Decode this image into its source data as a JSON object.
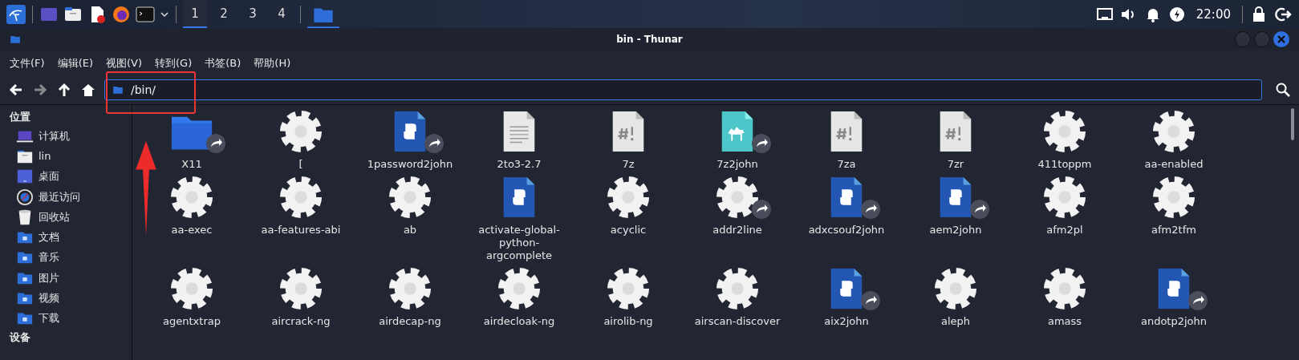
{
  "taskbar": {
    "workspaces": [
      {
        "label": "1",
        "selected": true
      },
      {
        "label": "2",
        "selected": false
      },
      {
        "label": "3",
        "selected": false
      },
      {
        "label": "4",
        "selected": false
      }
    ],
    "clock": "22:00"
  },
  "window": {
    "title": "bin - Thunar"
  },
  "menu": [
    "文件(F)",
    "编辑(E)",
    "视图(V)",
    "转到(G)",
    "书签(B)",
    "帮助(H)"
  ],
  "location": {
    "value": "/bin/"
  },
  "sidebar": {
    "sections": [
      {
        "title": "位置",
        "items": [
          {
            "label": "计算机",
            "kind": "computer"
          },
          {
            "label": "lin",
            "kind": "home"
          },
          {
            "label": "桌面",
            "kind": "desktop"
          },
          {
            "label": "最近访问",
            "kind": "recent"
          },
          {
            "label": "回收站",
            "kind": "trash"
          },
          {
            "label": "文档",
            "kind": "documents"
          },
          {
            "label": "音乐",
            "kind": "music"
          },
          {
            "label": "图片",
            "kind": "pictures"
          },
          {
            "label": "视频",
            "kind": "videos"
          },
          {
            "label": "下载",
            "kind": "downloads"
          }
        ]
      },
      {
        "title": "设备"
      }
    ]
  },
  "files": [
    {
      "name": "X11",
      "kind": "folder",
      "link": true
    },
    {
      "name": "[",
      "kind": "binary",
      "link": false
    },
    {
      "name": "1password2john",
      "kind": "python",
      "link": true
    },
    {
      "name": "2to3-2.7",
      "kind": "text",
      "link": false
    },
    {
      "name": "7z",
      "kind": "script",
      "link": false
    },
    {
      "name": "7z2john",
      "kind": "perl",
      "link": true
    },
    {
      "name": "7za",
      "kind": "script",
      "link": false
    },
    {
      "name": "7zr",
      "kind": "script",
      "link": false
    },
    {
      "name": "411toppm",
      "kind": "binary",
      "link": false
    },
    {
      "name": "aa-enabled",
      "kind": "binary",
      "link": false
    },
    {
      "name": "aa-exec",
      "kind": "binary",
      "link": false
    },
    {
      "name": "aa-features-abi",
      "kind": "binary",
      "link": false
    },
    {
      "name": "ab",
      "kind": "binary",
      "link": false
    },
    {
      "name": "activate-global-python-argcomplete",
      "kind": "python",
      "link": false
    },
    {
      "name": "acyclic",
      "kind": "binary",
      "link": false
    },
    {
      "name": "addr2line",
      "kind": "binary",
      "link": true
    },
    {
      "name": "adxcsouf2john",
      "kind": "python",
      "link": true
    },
    {
      "name": "aem2john",
      "kind": "python",
      "link": true
    },
    {
      "name": "afm2pl",
      "kind": "binary",
      "link": false
    },
    {
      "name": "afm2tfm",
      "kind": "binary",
      "link": false
    },
    {
      "name": "agentxtrap",
      "kind": "binary",
      "link": false
    },
    {
      "name": "aircrack-ng",
      "kind": "binary",
      "link": false
    },
    {
      "name": "airdecap-ng",
      "kind": "binary",
      "link": false
    },
    {
      "name": "airdecloak-ng",
      "kind": "binary",
      "link": false
    },
    {
      "name": "airolib-ng",
      "kind": "binary",
      "link": false
    },
    {
      "name": "airscan-discover",
      "kind": "binary",
      "link": false
    },
    {
      "name": "aix2john",
      "kind": "python",
      "link": true
    },
    {
      "name": "aleph",
      "kind": "binary",
      "link": false
    },
    {
      "name": "amass",
      "kind": "binary",
      "link": false
    },
    {
      "name": "andotp2john",
      "kind": "python",
      "link": true
    }
  ]
}
